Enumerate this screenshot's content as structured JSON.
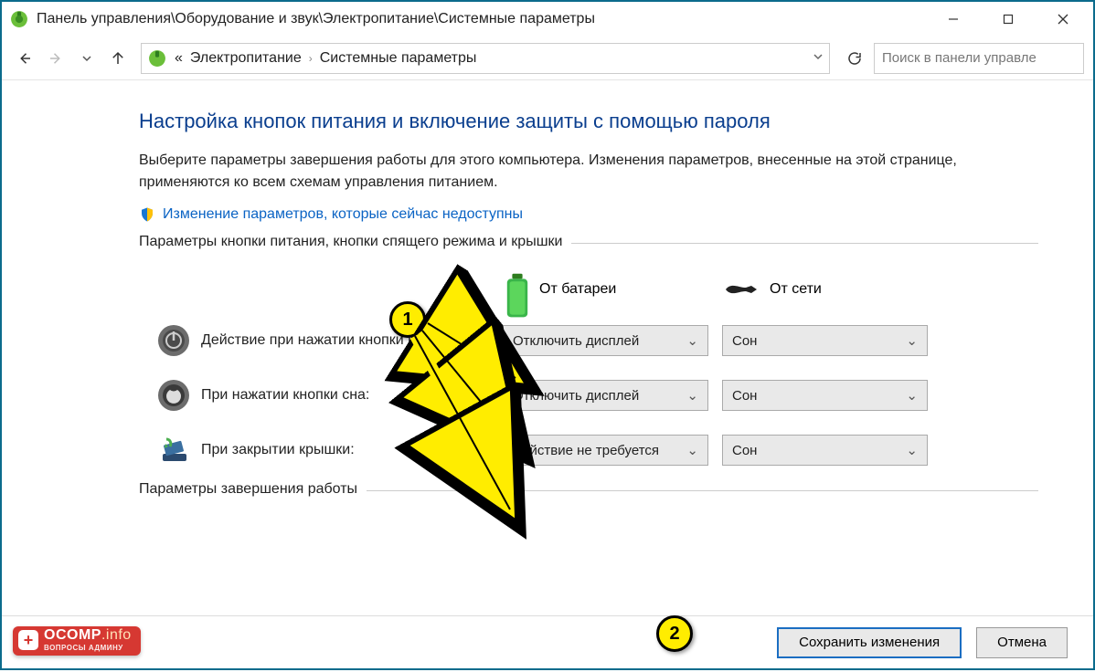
{
  "window": {
    "title": "Панель управления\\Оборудование и звук\\Электропитание\\Системные параметры"
  },
  "breadcrumb": {
    "prefix": "«",
    "items": [
      "Электропитание",
      "Системные параметры"
    ]
  },
  "search": {
    "placeholder": "Поиск в панели управле"
  },
  "page": {
    "heading": "Настройка кнопок питания и включение защиты с помощью пароля",
    "description": "Выберите параметры завершения работы для этого компьютера. Изменения параметров, внесенные на этой странице, применяются ко всем схемам управления питанием.",
    "uac_link": "Изменение параметров, которые сейчас недоступны"
  },
  "group1": {
    "legend": "Параметры кнопки питания, кнопки спящего режима и крышки",
    "col_battery": "От батареи",
    "col_ac": "От сети",
    "rows": [
      {
        "label": "Действие при нажатии кнопки питания:",
        "battery": "Отключить дисплей",
        "ac": "Сон"
      },
      {
        "label": "При нажатии кнопки сна:",
        "battery": "Отключить дисплей",
        "ac": "Сон"
      },
      {
        "label": "При закрытии крышки:",
        "battery": "Действие не требуется",
        "ac": "Сон"
      }
    ]
  },
  "group2": {
    "legend": "Параметры завершения работы"
  },
  "footer": {
    "save": "Сохранить изменения",
    "cancel": "Отмена"
  },
  "watermark": {
    "main": "OCOMP",
    "suffix": ".info",
    "sub": "ВОПРОСЫ АДМИНУ"
  },
  "annotations": {
    "marker1": "1",
    "marker2": "2"
  }
}
